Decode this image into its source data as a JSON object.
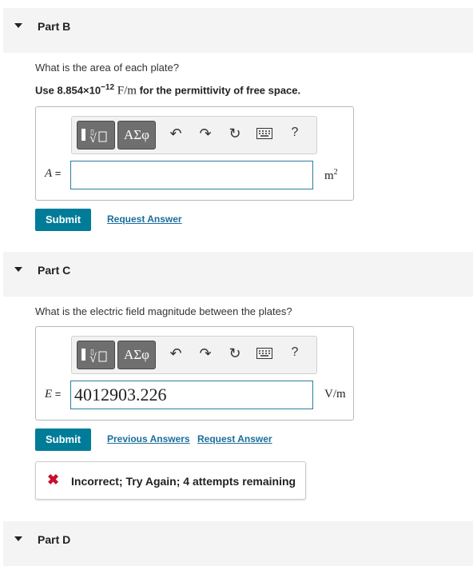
{
  "part_b": {
    "title": "Part B",
    "question": "What is the area of each plate?",
    "hint_prefix": "Use 8.854×10",
    "hint_exp": "−12",
    "hint_unit": " F/m",
    "hint_suffix": " for the permittivity of free space.",
    "var_label": "A",
    "eq": " =",
    "input_value": "",
    "unit": "m",
    "unit_exp": "2",
    "submit_label": "Submit",
    "request_answer": "Request Answer"
  },
  "part_c": {
    "title": "Part C",
    "question": "What is the electric field magnitude between the plates?",
    "var_label": "E",
    "eq": " =",
    "input_value": "4012903.226",
    "unit": "V/m",
    "submit_label": "Submit",
    "previous_answers": "Previous Answers",
    "request_answer": "Request Answer",
    "feedback_icon": "✖",
    "feedback": "Incorrect; Try Again; 4 attempts remaining"
  },
  "part_d": {
    "title": "Part D"
  },
  "toolbar": {
    "greek_label": "ΑΣφ",
    "help_label": "?",
    "icons": [
      "templates-icon",
      "greek-symbols-icon",
      "undo-icon",
      "redo-icon",
      "reset-icon",
      "keyboard-icon",
      "help-icon"
    ]
  },
  "colors": {
    "accent": "#007c99",
    "link": "#1b6e9b",
    "error": "#c8102e",
    "header_bg": "#f4f4f4"
  }
}
